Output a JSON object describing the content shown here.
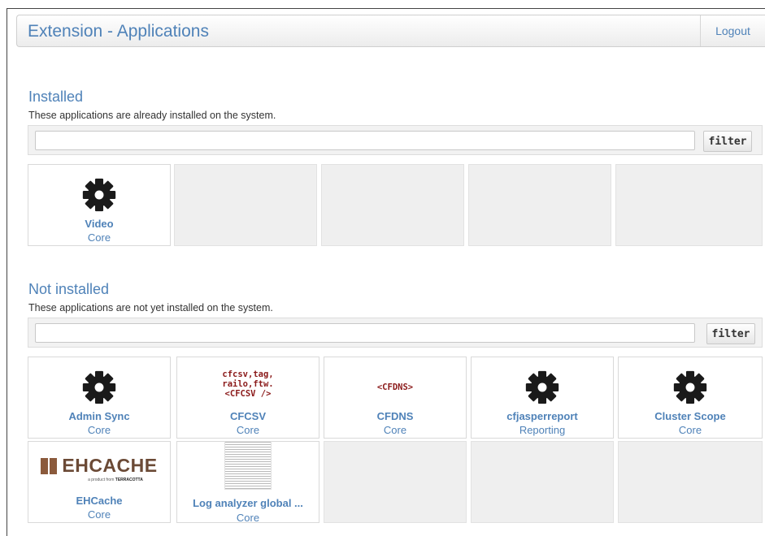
{
  "header": {
    "title": "Extension - Applications",
    "logout_label": "Logout"
  },
  "installed": {
    "title": "Installed",
    "description": "These applications are already installed on the system.",
    "filter_value": "",
    "filter_label": "filter",
    "apps": [
      {
        "name": "Video",
        "category": "Core",
        "icon": "gear-icon"
      }
    ]
  },
  "not_installed": {
    "title": "Not installed",
    "description": "These applications are not yet installed on the system.",
    "filter_value": "",
    "filter_label": "filter",
    "apps": [
      {
        "name": "Admin Sync",
        "category": "Core",
        "icon": "gear-icon"
      },
      {
        "name": "CFCSV",
        "category": "Core",
        "icon": "cfcsv-logo",
        "icon_text": "cfcsv,tag,\nrailo,ftw.\n<CFCSV />"
      },
      {
        "name": "CFDNS",
        "category": "Core",
        "icon": "cfdns-logo",
        "icon_text": "<CFDNS>"
      },
      {
        "name": "cfjasperreport",
        "category": "Reporting",
        "icon": "gear-icon"
      },
      {
        "name": "Cluster Scope",
        "category": "Core",
        "icon": "gear-icon"
      },
      {
        "name": "EHCache",
        "category": "Core",
        "icon": "ehcache-logo",
        "icon_text": "EHCACHE",
        "icon_subtext_prefix": "a product from",
        "icon_subtext_brand": "TERRACOTTA"
      },
      {
        "name": "Log analyzer global ...",
        "category": "Core",
        "icon": "document-thumbnail-icon"
      }
    ]
  },
  "colors": {
    "accent": "#4f82b8",
    "empty_tile": "#efefef",
    "code_text": "#8b1a1a"
  }
}
